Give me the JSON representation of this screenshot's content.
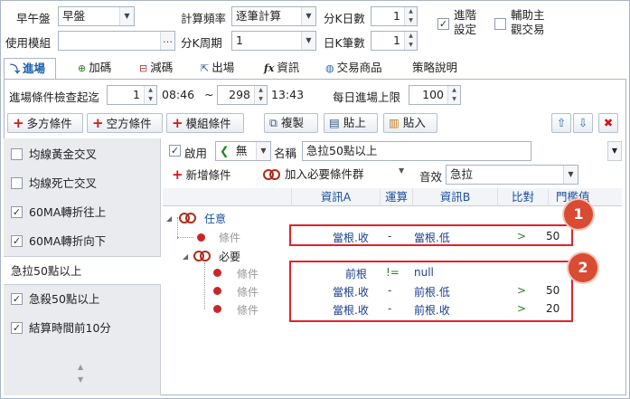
{
  "top": {
    "session_label": "早午盤",
    "session_value": "早盤",
    "freq_label": "計算頻率",
    "freq_value": "逐筆計算",
    "kdays_label": "分K日數",
    "kdays_value": "1",
    "advanced_label_1": "進階",
    "advanced_label_2": "設定",
    "aux_label_1": "輔助主",
    "aux_label_2": "觀交易",
    "module_label": "使用模組",
    "module_value": "",
    "module_btn": "…",
    "kperiod_label": "分K周期",
    "kperiod_value": "1",
    "daybars_label": "日K筆數",
    "daybars_value": "1"
  },
  "tabs": [
    {
      "label": "進場",
      "icon": "entry-icon"
    },
    {
      "label": "加碼",
      "icon": "add-icon"
    },
    {
      "label": "減碼",
      "icon": "reduce-icon"
    },
    {
      "label": "出場",
      "icon": "exit-icon"
    },
    {
      "label": "資訊",
      "icon": "fx-icon"
    },
    {
      "label": "交易商品",
      "icon": "globe-icon"
    },
    {
      "label": "策略說明",
      "icon": ""
    }
  ],
  "entry": {
    "check_label": "進場條件檢查起迄",
    "start_value": "1",
    "start_time": "08:46",
    "tilde": "~",
    "end_value": "298",
    "end_time": "13:43",
    "daily_label": "每日進場上限",
    "daily_value": "100"
  },
  "toolbar": {
    "multi": "多方條件",
    "short": "空方條件",
    "module": "模組條件",
    "copy": "複製",
    "paste_on": "貼上",
    "paste_in": "貼入"
  },
  "left_list": [
    {
      "label": "均線黃金交叉",
      "checked": false
    },
    {
      "label": "均線死亡交叉",
      "checked": false
    },
    {
      "label": "60MA轉折往上",
      "checked": true
    },
    {
      "label": "60MA轉折向下",
      "checked": true
    },
    {
      "label": "急拉50點以上",
      "checked": null
    },
    {
      "label": "急殺50點以上",
      "checked": true
    },
    {
      "label": "結算時間前10分",
      "checked": true
    }
  ],
  "detail": {
    "enable_label": "啟用",
    "mark_value": "無",
    "name_label": "名稱",
    "name_value": "急拉50點以上",
    "add_cond": "新增條件",
    "add_group": "加入必要條件群",
    "sound_label": "音效",
    "sound_value": "急拉"
  },
  "grid": {
    "headers": [
      "資訊A",
      "運算",
      "資訊B",
      "比對",
      "門檻值"
    ]
  },
  "tree": {
    "any_label": "任意",
    "must_label": "必要",
    "cond_label": "條件",
    "rows1": [
      {
        "a": "當根.收",
        "op": "-",
        "b": "當根.低",
        "cmp": ">",
        "val": "50"
      }
    ],
    "rows2": [
      {
        "a": "前根",
        "op": "!=",
        "b": "null",
        "cmp": "",
        "val": ""
      },
      {
        "a": "當根.收",
        "op": "-",
        "b": "前根.低",
        "cmp": ">",
        "val": "50"
      },
      {
        "a": "當根.收",
        "op": "-",
        "b": "前根.收",
        "cmp": ">",
        "val": "20"
      }
    ]
  },
  "badges": [
    "1",
    "2"
  ],
  "colors": {
    "accent": "#1b5fa8",
    "highlight": "#e0232b",
    "badge": "#d94b32"
  }
}
